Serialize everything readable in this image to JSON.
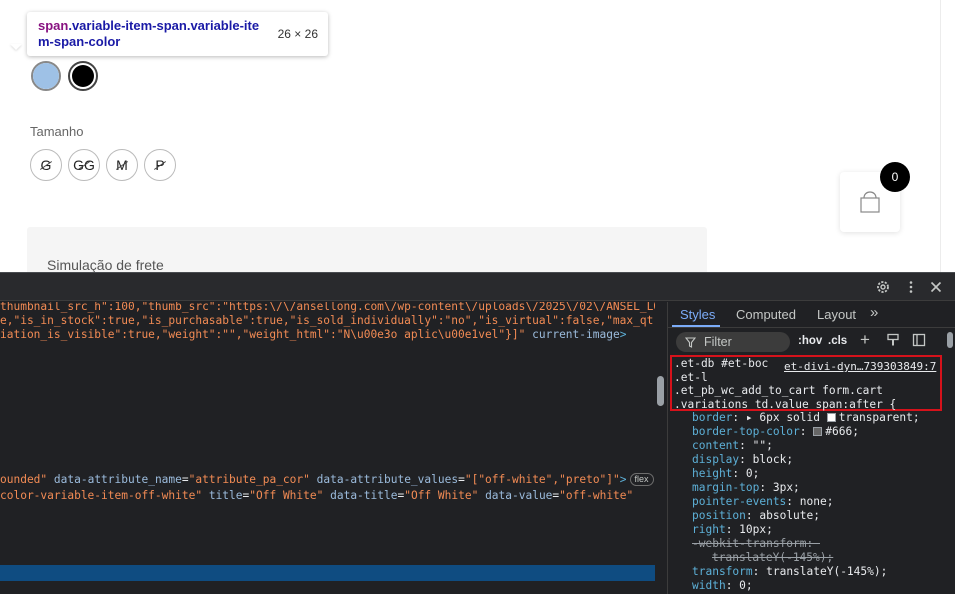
{
  "page": {
    "tooltip": {
      "tag": "span",
      "classes": ".variable-item-span.variable-item-span-color",
      "size": "26 × 26"
    },
    "label_tamanho": "Tamanho",
    "sizes": [
      "G",
      "GG",
      "M",
      "P"
    ],
    "frete_label": "Simulação de frete",
    "cart_count": "0",
    "cart_icon": "shopping-bag-icon",
    "swatch_colors": {
      "off_white": "#9ec1e6",
      "preto": "#000000"
    }
  },
  "devtools": {
    "element_lines": {
      "l1_str": "thumbnail_src_h\":100,\"thumb_src\":\"https:\\/\\/ansellong.com\\/wp-content\\/uploads\\/2025\\/02\\/ANSEL_LO",
      "l2_str": "e,\"is_in_stock\":true,\"is_purchasable\":true,\"is_sold_individually\":\"no\",\"is_virtual\":false,\"max_qt",
      "l3_str": "iation_is_visible\":true,\"weight\":\"\",\"weight_html\":\"N\\u00e3o aplic\\u00e1vel\"}]\"",
      "l3_attr": "current-image",
      "l3_end": ">",
      "l4_str": "ounded\"",
      "l4_attr1": "data-attribute_name",
      "l4_val1": "\"attribute_pa_cor\"",
      "l4_attr2": "data-attribute_values",
      "l4_val2": "\"[\"off-white\",\"preto\"]\"",
      "l4_end": ">",
      "flex": "flex",
      "l5_str": "color-variable-item-off-white\"",
      "l5_attr1": "title",
      "l5_val1": "\"Off White\"",
      "l5_attr2": "data-title",
      "l5_val2": "\"Off White\"",
      "l5_attr3": "data-value",
      "l5_val3": "\"off-white\""
    },
    "tabs": {
      "styles": "Styles",
      "computed": "Computed",
      "layout": "Layout",
      "more": "»"
    },
    "toolbar": {
      "filter": "Filter",
      "hov": ":hov",
      "cls": ".cls",
      "plus": "+"
    },
    "rule": {
      "selectors": [
        ".et-db #et-boc",
        ".et-l",
        ".et_pb_wc_add_to_cart form.cart",
        ".variations td.value span:after {"
      ],
      "source": "et-divi-dyn…739303849:7",
      "declarations": [
        {
          "prop": "border",
          "val": "▸ 6px solid",
          "swatch": "transparent",
          "rest": "transparent;"
        },
        {
          "prop": "border-top-color",
          "val": "",
          "swatch": "#666",
          "rest": "#666;"
        },
        {
          "prop": "content",
          "val": "\"\";"
        },
        {
          "prop": "display",
          "val": "block;"
        },
        {
          "prop": "height",
          "val": "0;"
        },
        {
          "prop": "margin-top",
          "val": "3px;"
        },
        {
          "prop": "pointer-events",
          "val": "none;"
        },
        {
          "prop": "position",
          "val": "absolute;"
        },
        {
          "prop": "right",
          "val": "10px;"
        },
        {
          "prop": "-webkit-transform",
          "val": "",
          "struck": true
        },
        {
          "prop": "",
          "val": "translateY(-145%);",
          "struck": true,
          "indent": true
        },
        {
          "prop": "transform",
          "val": "translateY(-145%);"
        },
        {
          "prop": "width",
          "val": "0;"
        }
      ]
    },
    "icons": [
      "gear-icon",
      "kebab-menu-icon",
      "close-icon",
      "filter-icon",
      "paint-icon",
      "toggle-sidebar-icon"
    ]
  }
}
